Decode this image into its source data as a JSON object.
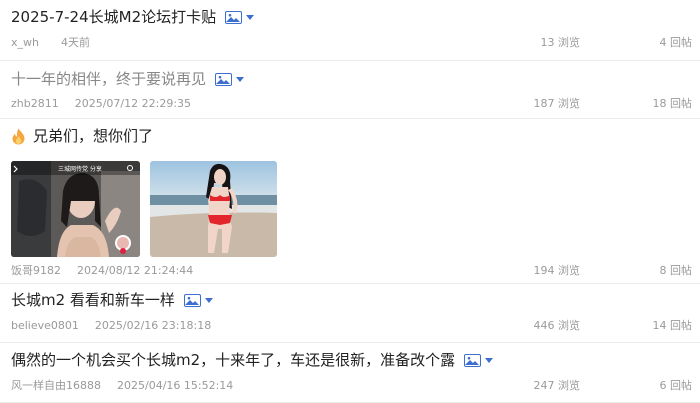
{
  "posts": [
    {
      "title": "2025-7-24长城M2论坛打卡贴",
      "author": "x_wh",
      "time": "4天前",
      "views": "13 浏览",
      "replies": "4 回帖"
    },
    {
      "title": "十一年的相伴，终于要说再见",
      "author": "zhb2811",
      "time": "2025/07/12 22:29:35",
      "views": "187 浏览",
      "replies": "18 回帖"
    },
    {
      "title": "兄弟们，想你们了",
      "author": "饭哥9182",
      "time": "2024/08/12 21:24:44",
      "views": "194 浏览",
      "replies": "8 回帖",
      "overlay_text": "三城网传党 分享"
    },
    {
      "title": "长城m2 看看和新车一样",
      "author": "believe0801",
      "time": "2025/02/16 23:18:18",
      "views": "446 浏览",
      "replies": "14 回帖"
    },
    {
      "title": "偶然的一个机会买个长城m2，十来年了，车还是很新，准备改个露",
      "author": "风一样自由16888",
      "time": "2025/04/16 15:52:14",
      "views": "247 浏览",
      "replies": "6 回帖"
    }
  ],
  "colors": {
    "accent": "#3d6fcf",
    "meta": "#9a9a9a",
    "read_title": "#888888"
  },
  "icons": {
    "image_indicator": "image-icon",
    "hot": "fire-icon"
  }
}
